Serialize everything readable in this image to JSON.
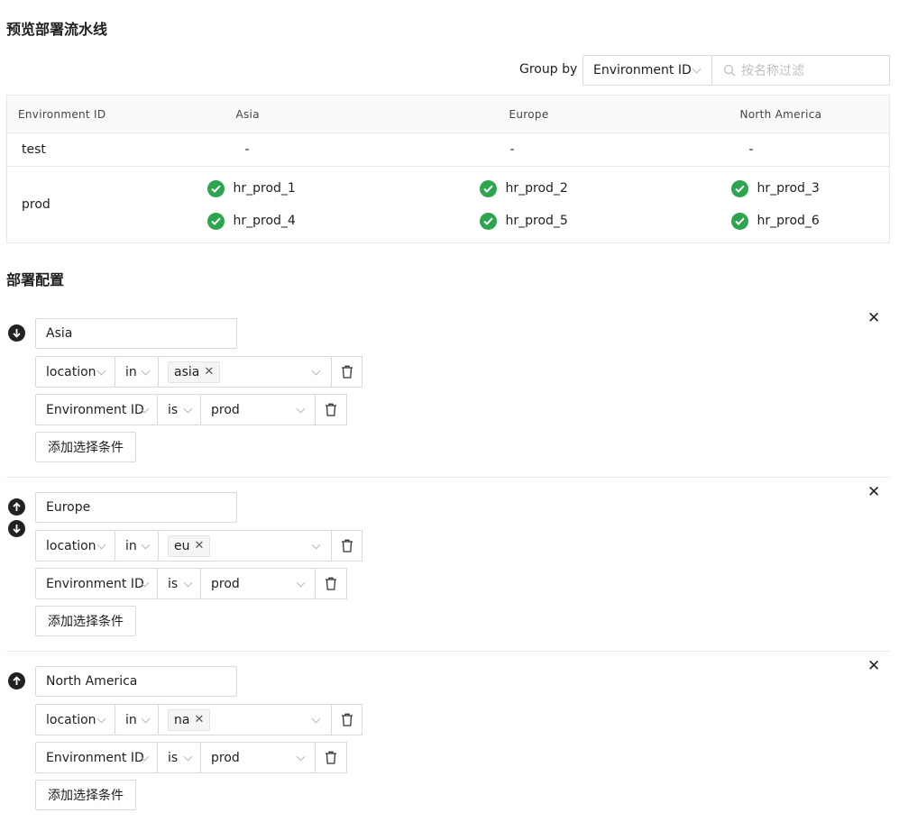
{
  "preview": {
    "title": "预览部署流水线",
    "group_by_label": "Group by",
    "group_by_value": "Environment ID",
    "filter_placeholder": "按名称过滤",
    "columns": [
      "Environment ID",
      "Asia",
      "Europe",
      "North America"
    ],
    "rows": [
      {
        "env": "test",
        "asia": [
          "-"
        ],
        "europe": [
          "-"
        ],
        "na": [
          "-"
        ]
      },
      {
        "env": "prod",
        "asia": [
          "hr_prod_1",
          "hr_prod_4"
        ],
        "europe": [
          "hr_prod_2",
          "hr_prod_5"
        ],
        "na": [
          "hr_prod_3",
          "hr_prod_6"
        ]
      }
    ]
  },
  "config": {
    "title": "部署配置",
    "add_condition_label": "添加选择条件",
    "groups": [
      {
        "name": "Asia",
        "key1": "location",
        "op1": "in",
        "tag": "asia",
        "key2": "Environment ID",
        "op2": "is",
        "val2": "prod",
        "up": false,
        "down": true
      },
      {
        "name": "Europe",
        "key1": "location",
        "op1": "in",
        "tag": "eu",
        "key2": "Environment ID",
        "op2": "is",
        "val2": "prod",
        "up": true,
        "down": true
      },
      {
        "name": "North America",
        "key1": "location",
        "op1": "in",
        "tag": "na",
        "key2": "Environment ID",
        "op2": "is",
        "val2": "prod",
        "up": true,
        "down": false
      }
    ]
  },
  "colors": {
    "success": "#2da44e",
    "border": "#d9d9d9",
    "header_bg": "#fafafa"
  }
}
